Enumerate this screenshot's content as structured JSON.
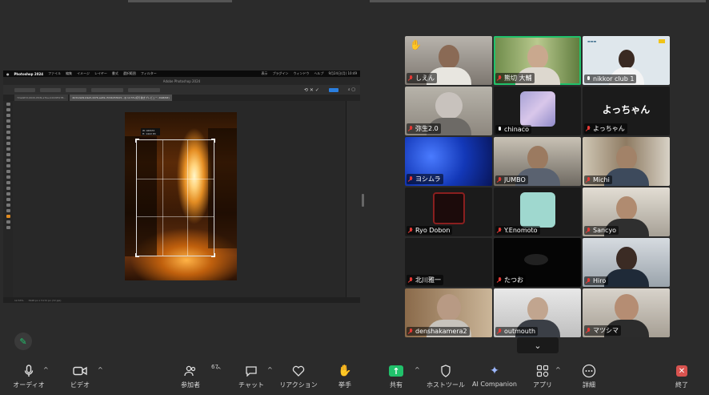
{
  "shared_screen": {
    "app_name": "Photoshop 2024",
    "menu": [
      "ファイル",
      "編集",
      "イメージ",
      "レイヤー",
      "書式",
      "選択範囲",
      "フィルター"
    ],
    "menu_right": [
      "表示",
      "プラグイン",
      "ウィンドウ",
      "ヘルプ"
    ],
    "clock": "9月24日(月) 10:49",
    "window_title": "Adobe Photoshop 2024",
    "tabs": [
      "72aa9fc0-b6d0-45d9-a7be-b44d95178...",
      "4b312a09-b9e5-4476-aa59-cf2db453915...@ 12.5%(切り抜きプレビュー, RGB/8#)"
    ],
    "crop_info_line1": "W: 948 PX",
    "crop_info_line2": "H: 1422 PX",
    "status_zoom": "12.53%",
    "status_size": "3448 px x 5172 px (72 ppi)"
  },
  "participants": [
    {
      "name": "しえん",
      "muted": true,
      "hand_raised": true,
      "kind": "video"
    },
    {
      "name": "熊切 大輔",
      "muted": true,
      "active_speaker": true,
      "kind": "video"
    },
    {
      "name": "nikkor club 1",
      "muted": false,
      "kind": "video"
    },
    {
      "name": "弥生2.0",
      "muted": true,
      "kind": "video"
    },
    {
      "name": "chinaco",
      "muted": false,
      "kind": "avatar"
    },
    {
      "name": "よっちゃん",
      "muted": true,
      "kind": "text",
      "display_text": "よっちゃん"
    },
    {
      "name": "ヨシムラ",
      "muted": true,
      "kind": "jellyfish"
    },
    {
      "name": "JUMBO",
      "muted": true,
      "kind": "video"
    },
    {
      "name": "Michi",
      "muted": true,
      "kind": "video"
    },
    {
      "name": "Ryo Dobon",
      "muted": true,
      "kind": "seal"
    },
    {
      "name": "Y.Enomoto",
      "muted": true,
      "kind": "cartoon"
    },
    {
      "name": "Sancyo",
      "muted": true,
      "kind": "video"
    },
    {
      "name": "北川雅一",
      "muted": true,
      "kind": "dark"
    },
    {
      "name": "たつお",
      "muted": true,
      "kind": "dark"
    },
    {
      "name": "Hiro",
      "muted": true,
      "kind": "video"
    },
    {
      "name": "denshakamera2",
      "muted": true,
      "kind": "video"
    },
    {
      "name": "outmouth",
      "muted": true,
      "kind": "video"
    },
    {
      "name": "マツシマ",
      "muted": true,
      "kind": "video"
    }
  ],
  "toolbar": {
    "audio": "オーディオ",
    "video": "ビデオ",
    "participants": "参加者",
    "participants_count": "67",
    "chat": "チャット",
    "reactions": "リアクション",
    "raise_hand": "挙手",
    "share": "共有",
    "host_tools": "ホストツール",
    "ai_companion": "AI Companion",
    "apps": "アプリ",
    "more": "詳細",
    "end": "終了"
  },
  "colors": {
    "active_speaker": "#21c16b",
    "muted_mic": "#e53935",
    "share_button": "#21c16b",
    "end_button": "#d9534f"
  }
}
